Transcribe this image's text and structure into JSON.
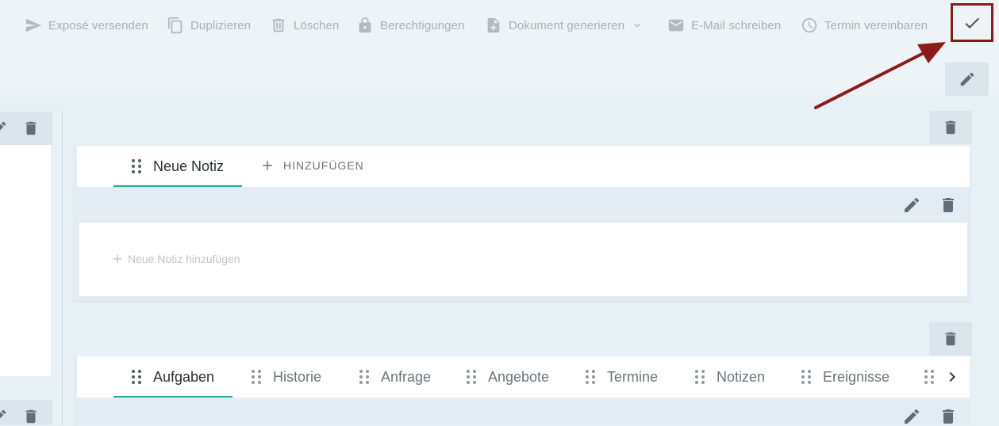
{
  "toolbar": {
    "items": [
      {
        "label": "Exposé versenden",
        "icon": "send-icon"
      },
      {
        "label": "Duplizieren",
        "icon": "copy-icon"
      },
      {
        "label": "Löschen",
        "icon": "delete-icon"
      },
      {
        "label": "Berechtigungen",
        "icon": "lock-icon"
      },
      {
        "label": "Dokument generieren",
        "icon": "document-add-icon",
        "dropdown": true
      },
      {
        "label": "E-Mail schreiben",
        "icon": "mail-icon"
      },
      {
        "label": "Termin vereinbaren",
        "icon": "clock-icon"
      }
    ],
    "confirm_icon": "checkmark-icon",
    "highlight_color": "#8b1a1a"
  },
  "notes_panel": {
    "tabs": [
      {
        "label": "Neue Notiz",
        "active": true
      }
    ],
    "add_label": "HINZUFÜGEN",
    "add_note_label": "Neue Notiz hinzufügen"
  },
  "tasks_panel": {
    "tabs": [
      {
        "label": "Aufgaben",
        "active": true
      },
      {
        "label": "Historie"
      },
      {
        "label": "Anfrage"
      },
      {
        "label": "Angebote"
      },
      {
        "label": "Termine"
      },
      {
        "label": "Notizen"
      },
      {
        "label": "Ereignisse"
      }
    ]
  },
  "colors": {
    "accent": "#26a69a",
    "background": "#e6f0f5",
    "annotation": "#8b1a1a"
  }
}
